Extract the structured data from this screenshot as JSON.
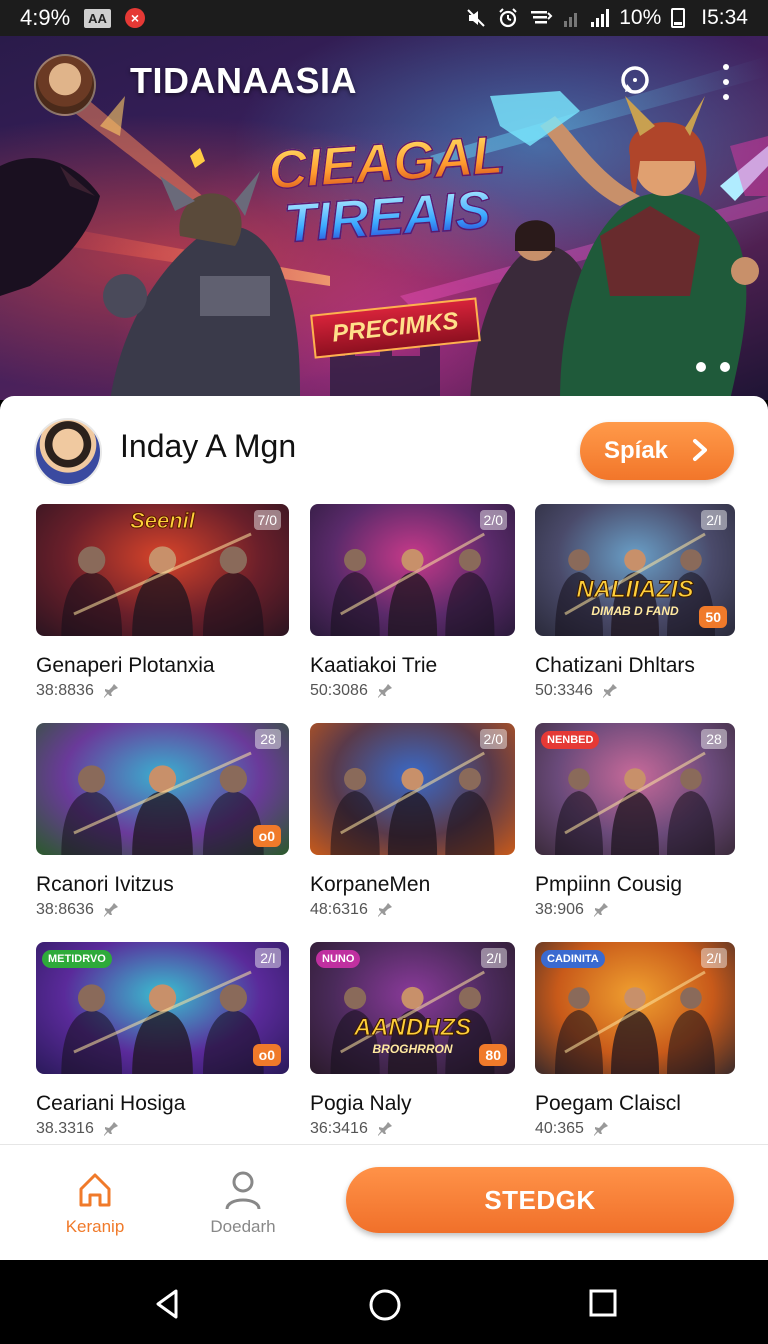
{
  "status_bar": {
    "left_text": "4:9%",
    "aa_badge": "AA",
    "x_badge": "×",
    "battery": "10%",
    "time": "I5:34"
  },
  "hero": {
    "app_title": "TIDANAASIA",
    "logo_line1": "CIEAGAL",
    "logo_line2": "TIREAIS",
    "subtitle": "PRECIMKS",
    "pager_count": 2,
    "icons": [
      "chat-icon",
      "more-vert-icon"
    ]
  },
  "user": {
    "name": "Inday A Mgn",
    "action_label": "Spíak"
  },
  "games": [
    {
      "title": "Genaperi Plotanxia",
      "meta": "38:8836",
      "badge": "7/0",
      "thumb_title": "Seenil",
      "tag": "",
      "price": "",
      "palette": [
        "#d8442a",
        "#6a1f2a",
        "#2a1420"
      ]
    },
    {
      "title": "Kaatiakoi Trie",
      "meta": "50:3086",
      "badge": "2/0",
      "thumb_title": "",
      "tag": "",
      "price": "",
      "palette": [
        "#c83a8a",
        "#5a2a6a",
        "#2a1a3a"
      ]
    },
    {
      "title": "Chatizani Dhltars",
      "meta": "50:3346",
      "badge": "2/I",
      "thumb_title": "NALIIAZIS",
      "thumb_subtitle": "DIMAB D FAND",
      "tag": "",
      "price": "50",
      "palette": [
        "#6aa0c8",
        "#4a4a6a",
        "#2a2a3a"
      ]
    },
    {
      "title": "Rcanori Ivitzus",
      "meta": "38:8636",
      "badge": "28",
      "thumb_title": "",
      "tag": "",
      "price": "o0",
      "palette": [
        "#3ab0d0",
        "#6a3a9a",
        "#2a5a2a"
      ]
    },
    {
      "title": "KorpaneMen",
      "meta": "48:6316",
      "badge": "2/0",
      "thumb_title": "",
      "tag": "",
      "price": "",
      "palette": [
        "#3a6ac8",
        "#5a3a4a",
        "#c85a1a"
      ]
    },
    {
      "title": "Pmpiinn Cousig",
      "meta": "38:906",
      "badge": "28",
      "thumb_title": "",
      "tag": "NENBED",
      "tag_color": "#e53935",
      "price": "",
      "palette": [
        "#c86a9a",
        "#6a4a7a",
        "#3a2a3a"
      ]
    },
    {
      "title": "Ceariani Hosiga",
      "meta": "38.3316",
      "badge": "2/I",
      "thumb_title": "",
      "tag": "METIDRVO",
      "tag_color": "#2eaa3a",
      "price": "o0",
      "palette": [
        "#3ac0d0",
        "#5a2a9a",
        "#2a1a5a"
      ]
    },
    {
      "title": "Pogia Naly",
      "meta": "36:3416",
      "badge": "2/I",
      "thumb_title": "AANDHZS",
      "thumb_subtitle": "BROGHRRON",
      "tag": "NUNO",
      "tag_color": "#c030a0",
      "price": "80",
      "palette": [
        "#8a3a9a",
        "#4a2a5a",
        "#2a1a2a"
      ]
    },
    {
      "title": "Poegam Claiscl",
      "meta": "40:365",
      "badge": "2/I",
      "thumb_title": "",
      "tag": "CADINITA",
      "tag_color": "#3a6ad0",
      "price": "",
      "palette": [
        "#f0a030",
        "#c85a1a",
        "#3a2a2a"
      ]
    }
  ],
  "bottom_nav": {
    "home_label": "Keranip",
    "profile_label": "Doedarh",
    "cta_label": "STEDGK",
    "accent": "#f07a2a"
  },
  "system_nav": {
    "icons": [
      "back-icon",
      "home-circle-icon",
      "recents-icon"
    ]
  }
}
